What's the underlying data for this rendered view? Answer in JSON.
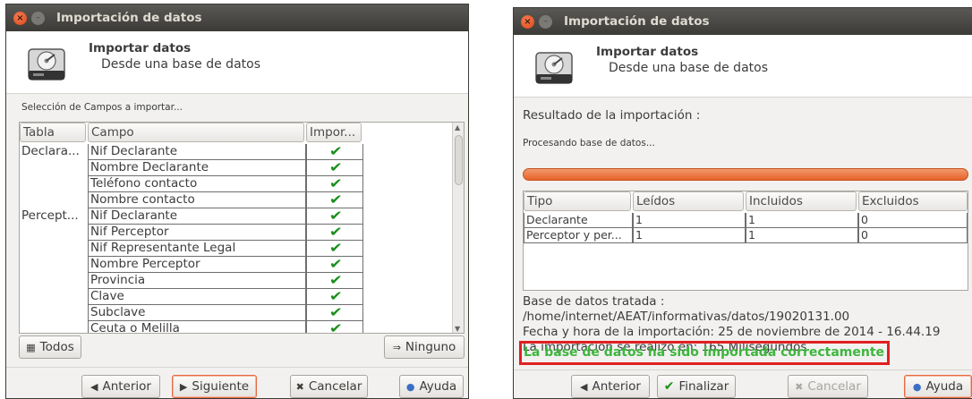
{
  "left": {
    "window_title": "Importación de datos",
    "header_title": "Importar datos",
    "header_subtitle": "Desde una base de datos",
    "section_label": "Selección de Campos a importar...",
    "columns": [
      "Tabla",
      "Campo",
      "Impor..."
    ],
    "rows": [
      {
        "tabla": "Declara...",
        "campo": "Nif Declarante",
        "checked": "✔"
      },
      {
        "tabla": "",
        "campo": "Nombre Declarante",
        "checked": "✔"
      },
      {
        "tabla": "",
        "campo": "Teléfono contacto",
        "checked": "✔"
      },
      {
        "tabla": "",
        "campo": "Nombre contacto",
        "checked": "✔"
      },
      {
        "tabla": "Percept...",
        "campo": "Nif Declarante",
        "checked": "✔"
      },
      {
        "tabla": "",
        "campo": "Nif Perceptor",
        "checked": "✔"
      },
      {
        "tabla": "",
        "campo": "Nif Representante Legal",
        "checked": "✔"
      },
      {
        "tabla": "",
        "campo": "Nombre Perceptor",
        "checked": "✔"
      },
      {
        "tabla": "",
        "campo": "Provincia",
        "checked": "✔"
      },
      {
        "tabla": "",
        "campo": "Clave",
        "checked": "✔"
      },
      {
        "tabla": "",
        "campo": "Subclave",
        "checked": "✔"
      },
      {
        "tabla": "",
        "campo": "Ceuta o Melilla",
        "checked": "✔"
      }
    ],
    "btn_todos": "Todos",
    "btn_ninguno": "Ninguno",
    "btn_anterior": "Anterior",
    "btn_siguiente": "Siguiente",
    "btn_cancelar": "Cancelar",
    "btn_ayuda": "Ayuda"
  },
  "right": {
    "window_title": "Importación de datos",
    "header_title": "Importar datos",
    "header_subtitle": "Desde una base de datos",
    "result_label": "Resultado de la importación :",
    "processing_label": "Procesando base de datos...",
    "progress": 1.0,
    "columns": [
      "Tipo",
      "Leídos",
      "Incluidos",
      "Excluidos"
    ],
    "rows": [
      {
        "tipo": "Declarante",
        "leidos": "1",
        "incluidos": "1",
        "excluidos": "0"
      },
      {
        "tipo": "Perceptor y per...",
        "leidos": "1",
        "incluidos": "1",
        "excluidos": "0"
      }
    ],
    "info_db_label": "Base de datos tratada :",
    "info_db_path": "/home/internet/AEAT/informativas/datos/19020131.00",
    "info_datetime": "Fecha y hora de la importación: 25 de noviembre de 2014 - 16.44.19",
    "info_duration": "La importación se realizó en: 165 Milisegundos",
    "success_message": "La base de datos ha sido importada correctamente",
    "btn_anterior": "Anterior",
    "btn_finalizar": "Finalizar",
    "btn_cancelar": "Cancelar",
    "btn_ayuda": "Ayuda"
  },
  "colors": {
    "accent": "#e8632a",
    "success": "#3eb53e",
    "highlight": "#e02020",
    "check": "#1d8f1d"
  }
}
